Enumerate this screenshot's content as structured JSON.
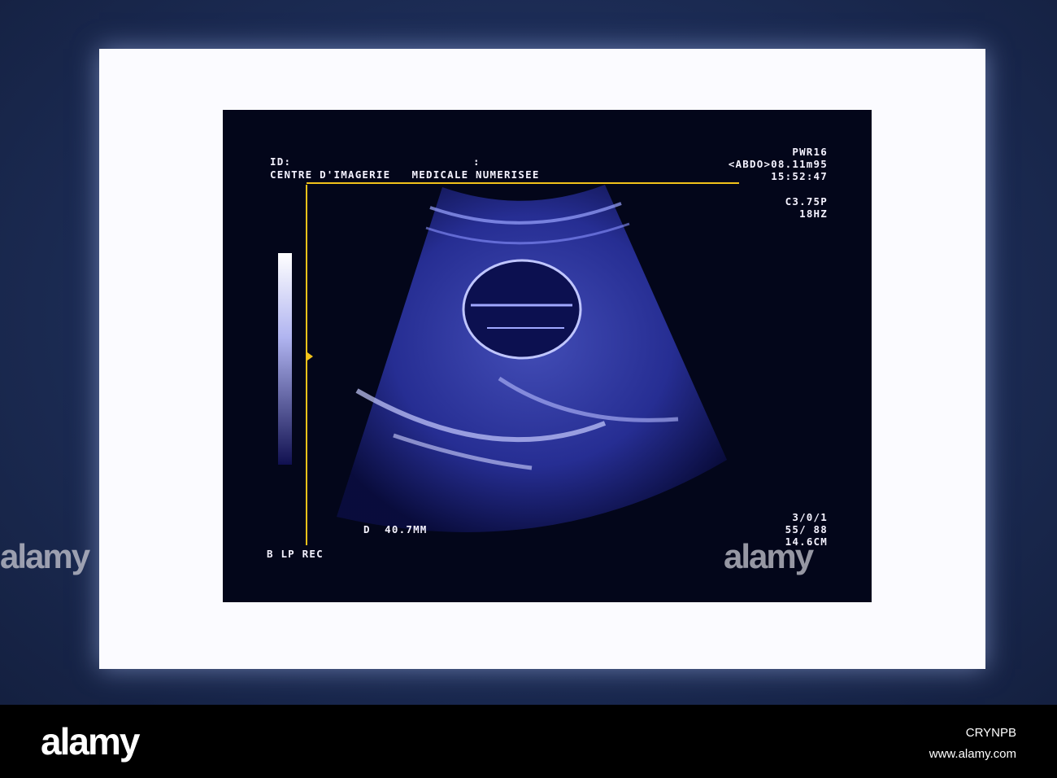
{
  "overlay": {
    "id_label": "ID:",
    "colon": ":",
    "institution": "CENTRE D'IMAGERIE   MEDICALE NUMERISEE",
    "power": "PWR16",
    "mode_date": "<ABDO>08.11m95",
    "time": "15:52:47",
    "probe": "C3.75P",
    "frame_rate": "18HZ",
    "measurement": "D  40.7MM",
    "mode": "B LP REC",
    "settings": "3/0/1",
    "gain": "55/ 88",
    "depth": "14.6CM"
  },
  "watermark": {
    "text": "alamy",
    "small": "a"
  },
  "footer": {
    "logo": "alamy",
    "image_id": "CRYNPB",
    "url": "www.alamy.com"
  },
  "colors": {
    "caliper": "#f2c21a",
    "echo": "#6a78ff"
  }
}
